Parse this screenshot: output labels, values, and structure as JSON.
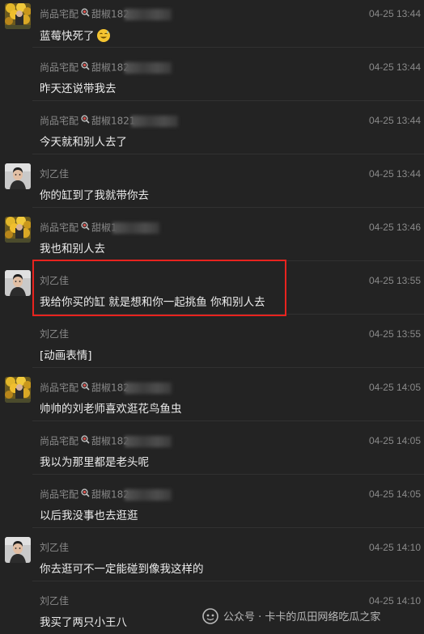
{
  "messages": [
    {
      "avatar": "shop",
      "sender": "尚品宅配",
      "sender_suffix": "甜椒182",
      "show_icon": true,
      "time": "04-25 13:44",
      "text": "蓝莓快死了",
      "emoji": "sweat-smile-emoji"
    },
    {
      "avatar": "none",
      "sender": "尚品宅配",
      "sender_suffix": "甜椒182",
      "show_icon": true,
      "time": "04-25 13:44",
      "text": "昨天还说带我去"
    },
    {
      "avatar": "none",
      "sender": "尚品宅配",
      "sender_suffix": "甜椒1821",
      "show_icon": true,
      "time": "04-25 13:44",
      "text": "今天就和别人去了"
    },
    {
      "avatar": "person",
      "sender": "刘乙佳",
      "sender_suffix": "",
      "show_icon": false,
      "time": "04-25 13:44",
      "text": "你的缸到了我就带你去"
    },
    {
      "avatar": "shop",
      "sender": "尚品宅配",
      "sender_suffix": "甜椒1",
      "show_icon": true,
      "time": "04-25 13:46",
      "text": "我也和别人去"
    },
    {
      "avatar": "person",
      "sender": "刘乙佳",
      "sender_suffix": "",
      "show_icon": false,
      "time": "04-25 13:55",
      "text": "我给你买的缸 就是想和你一起挑鱼 你和别人去"
    },
    {
      "avatar": "none",
      "sender": "刘乙佳",
      "sender_suffix": "",
      "show_icon": false,
      "time": "04-25 13:55",
      "text": "[动画表情]"
    },
    {
      "avatar": "shop",
      "sender": "尚品宅配",
      "sender_suffix": "甜椒182",
      "show_icon": true,
      "time": "04-25 14:05",
      "text": "帅帅的刘老师喜欢逛花鸟鱼虫"
    },
    {
      "avatar": "none",
      "sender": "尚品宅配",
      "sender_suffix": "甜椒182",
      "show_icon": true,
      "time": "04-25 14:05",
      "text": "我以为那里都是老头呢"
    },
    {
      "avatar": "none",
      "sender": "尚品宅配",
      "sender_suffix": "甜椒182",
      "show_icon": true,
      "time": "04-25 14:05",
      "text": "以后我没事也去逛逛"
    },
    {
      "avatar": "person",
      "sender": "刘乙佳",
      "sender_suffix": "",
      "show_icon": false,
      "time": "04-25 14:10",
      "text": "你去逛可不一定能碰到像我这样的"
    },
    {
      "avatar": "none",
      "sender": "刘乙佳",
      "sender_suffix": "",
      "show_icon": false,
      "time": "04-25 14:10",
      "text": "我买了两只小王八"
    }
  ],
  "highlight_color": "#e8231e",
  "watermark": "公众号 · 卡卡的瓜田网络吃瓜之家",
  "colors": {
    "background": "#232323",
    "text": "#ececec",
    "meta": "#8a8a8a"
  }
}
